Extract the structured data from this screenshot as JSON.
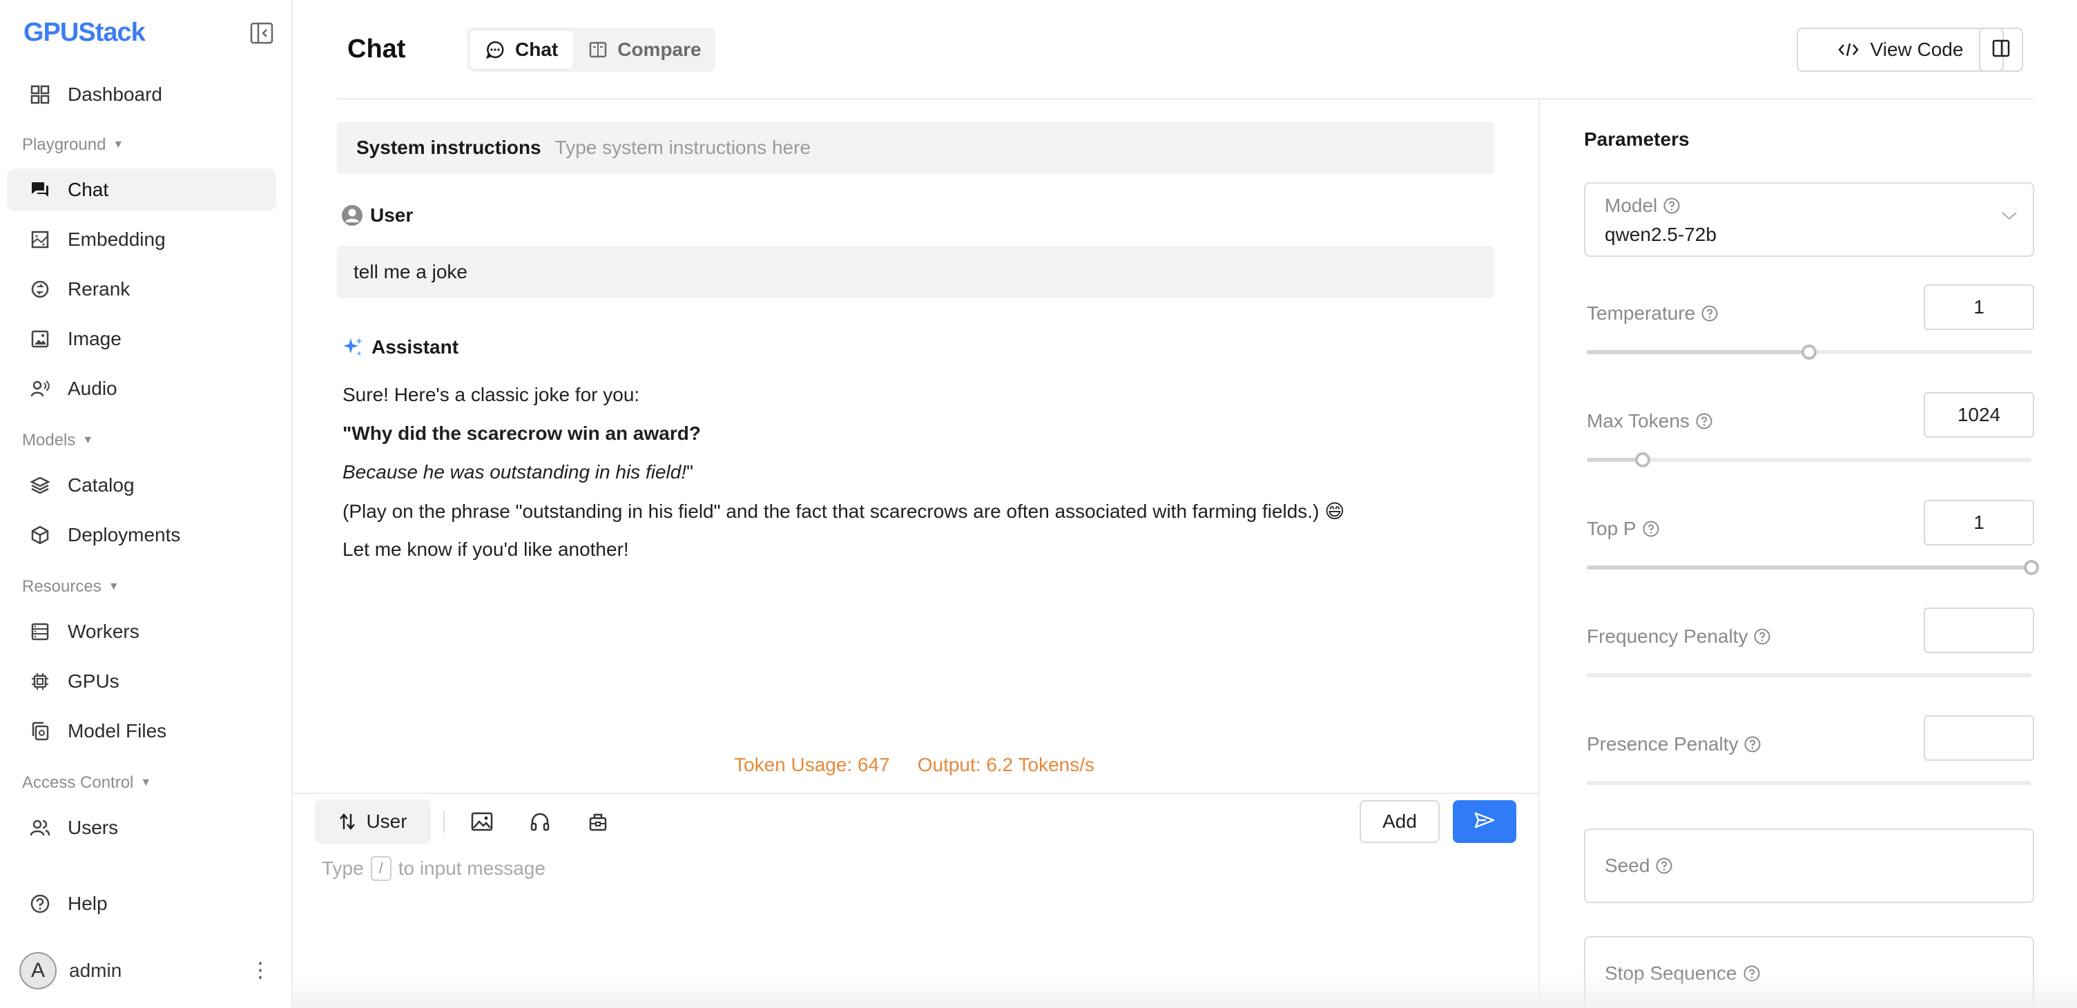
{
  "app": {
    "logo_text": "GPUStack"
  },
  "sidebar": {
    "dashboard": "Dashboard",
    "groups": {
      "playground": "Playground",
      "models": "Models",
      "resources": "Resources",
      "access_control": "Access Control"
    },
    "items": {
      "chat": "Chat",
      "embedding": "Embedding",
      "rerank": "Rerank",
      "image": "Image",
      "audio": "Audio",
      "catalog": "Catalog",
      "deployments": "Deployments",
      "workers": "Workers",
      "gpus": "GPUs",
      "model_files": "Model Files",
      "users": "Users",
      "help": "Help"
    },
    "active_item": "chat",
    "user": {
      "avatar_letter": "A",
      "name": "admin"
    }
  },
  "header": {
    "title": "Chat",
    "tabs": [
      {
        "label": "Chat",
        "active": true
      },
      {
        "label": "Compare",
        "active": false
      }
    ],
    "view_code_label": "View Code"
  },
  "chat": {
    "system": {
      "label": "System instructions",
      "placeholder": "Type system instructions here"
    },
    "user_role": "User",
    "user_message": "tell me a joke",
    "assistant_role": "Assistant",
    "assistant_lines": [
      "Sure! Here's a classic joke for you:",
      "\"Why did the scarecrow win an award?",
      "Because he was outstanding in his field!",
      "\"",
      "(Play on the phrase \"outstanding in his field\" and the fact that scarecrows are often associated with farming fields.) 😄",
      "Let me know if you'd like another!"
    ],
    "token_usage": "Token Usage: 647",
    "output_speed": "Output: 6.2 Tokens/s"
  },
  "composer": {
    "role_label": "User",
    "add_label": "Add",
    "placeholder_before": "Type",
    "placeholder_key": "/",
    "placeholder_after": "to input message"
  },
  "parameters": {
    "title": "Parameters",
    "model": {
      "label": "Model",
      "value": "qwen2.5-72b"
    },
    "temperature": {
      "label": "Temperature",
      "value": "1",
      "fraction": 0.5
    },
    "max_tokens": {
      "label": "Max Tokens",
      "value": "1024",
      "fraction": 0.125
    },
    "top_p": {
      "label": "Top P",
      "value": "1",
      "fraction": 1.0
    },
    "frequency_penalty": {
      "label": "Frequency Penalty",
      "value": ""
    },
    "presence_penalty": {
      "label": "Presence Penalty",
      "value": ""
    },
    "seed": {
      "label": "Seed"
    },
    "stop_sequence": {
      "label": "Stop Sequence"
    }
  },
  "colors": {
    "accent": "#2f7cf6",
    "token_text": "#e8883a",
    "active_nav_bg": "#f2f2f2"
  },
  "icons": {
    "collapse": "sidebar-collapse-icon",
    "chat": "chat-bubble-icon",
    "compare": "compare-icon",
    "code": "code-icon",
    "panel": "panel-toggle-icon",
    "send": "send-icon",
    "sparkle": "sparkle-icon"
  }
}
